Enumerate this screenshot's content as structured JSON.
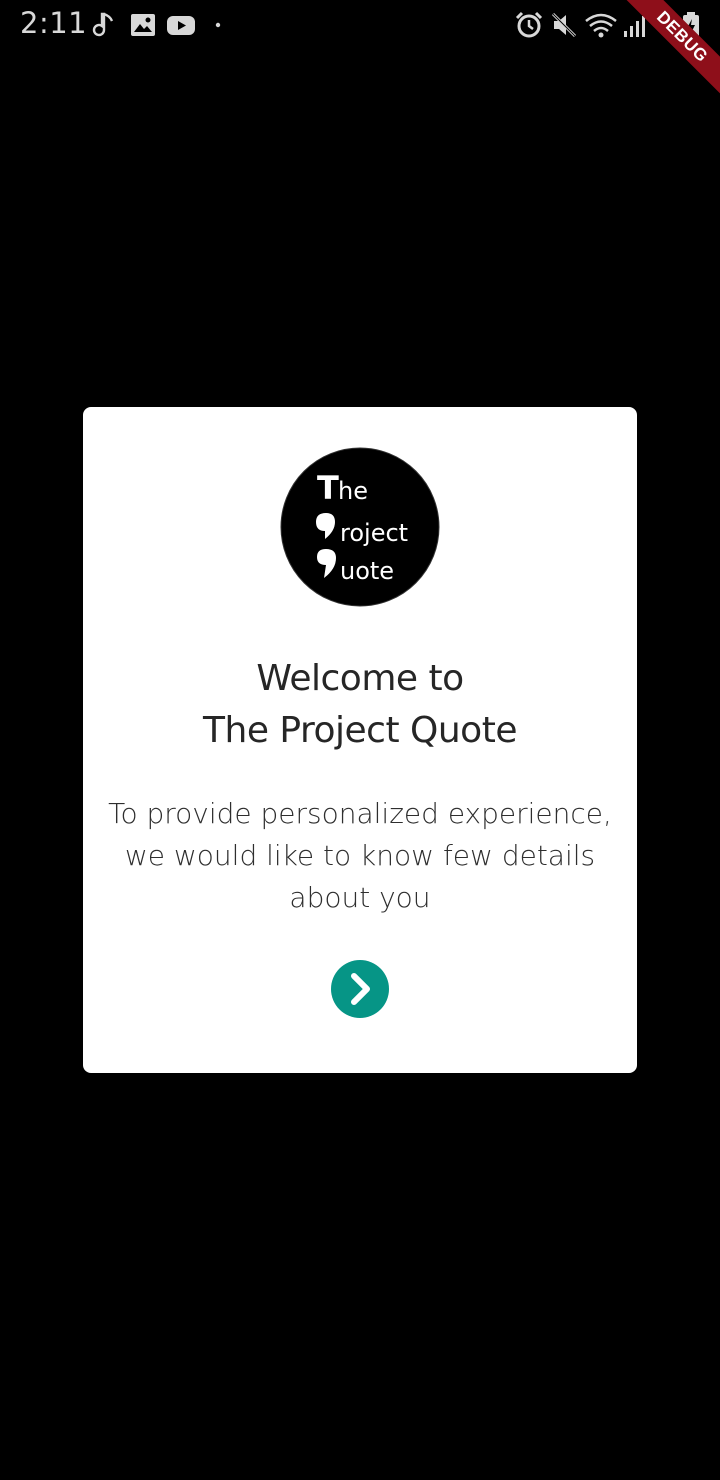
{
  "status_bar": {
    "time": "2:11",
    "left_icons": [
      "music-note-icon",
      "image-icon",
      "youtube-icon",
      "dot-icon"
    ],
    "right_icons": [
      "alarm-icon",
      "mute-icon",
      "wifi-icon",
      "signal-icon",
      "battery-icon"
    ]
  },
  "debug_banner": {
    "label": "DEBUG",
    "color": "#8e0f1a"
  },
  "dialog": {
    "logo": {
      "line1_initial": "T",
      "line1_rest": "he",
      "line2_rest": "roject",
      "line3_rest": "uote"
    },
    "title_line1": "Welcome to",
    "title_line2": "The Project Quote",
    "description": "To provide personalized experience, we would like to know few details about you",
    "next_button_icon": "chevron-right-icon",
    "accent_color": "#069586"
  }
}
